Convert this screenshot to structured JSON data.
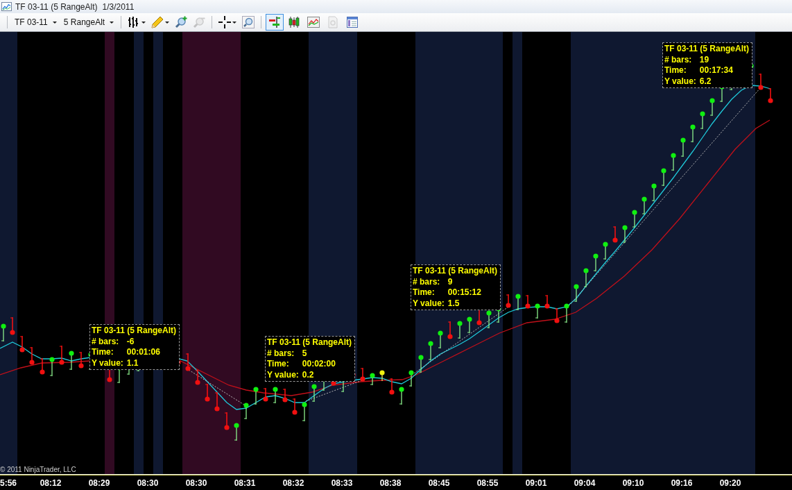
{
  "window": {
    "title": "TF 03-11 (5 RangeAlt)",
    "date": "1/3/2011"
  },
  "toolbar": {
    "instrument": "TF 03-11",
    "period": "5 RangeAlt",
    "tools": [
      {
        "disabled": false
      },
      {
        "disabled": false
      },
      {
        "disabled": false
      },
      {
        "disabled": true
      },
      {
        "disabled": false
      },
      {
        "disabled": false
      }
    ],
    "panels": [
      {
        "selected": true,
        "disabled": false
      },
      {
        "selected": false,
        "disabled": false
      },
      {
        "selected": false,
        "disabled": false
      },
      {
        "selected": false,
        "disabled": true
      },
      {
        "selected": false,
        "disabled": false
      }
    ]
  },
  "chart": {
    "measurements": [
      {
        "title": "TF 03-11 (5 RangeAlt)",
        "rows": [
          {
            "label": "# bars:",
            "value": "-6"
          },
          {
            "label": "Time:",
            "value": "00:01:06"
          },
          {
            "label": "Y value:",
            "value": "1.1"
          }
        ]
      },
      {
        "title": "TF 03-11 (5 RangeAlt)",
        "rows": [
          {
            "label": "# bars:",
            "value": "5"
          },
          {
            "label": "Time:",
            "value": "00:02:00"
          },
          {
            "label": "Y value:",
            "value": "0.2"
          }
        ]
      },
      {
        "title": "TF 03-11 (5 RangeAlt)",
        "rows": [
          {
            "label": "# bars:",
            "value": "9"
          },
          {
            "label": "Time:",
            "value": "00:15:12"
          },
          {
            "label": "Y value:",
            "value": "1.5"
          }
        ]
      },
      {
        "title": "TF 03-11 (5 RangeAlt)",
        "rows": [
          {
            "label": "# bars:",
            "value": "19"
          },
          {
            "label": "Time:",
            "value": "00:17:34"
          },
          {
            "label": "Y value:",
            "value": "6.2"
          }
        ]
      }
    ],
    "copyright": "© 2011 NinjaTrader, LLC",
    "time_axis": [
      "5:56",
      "08:12",
      "08:29",
      "08:30",
      "08:30",
      "08:31",
      "08:32",
      "08:33",
      "08:38",
      "08:45",
      "08:55",
      "09:01",
      "09:04",
      "09:10",
      "09:16",
      "09:20"
    ]
  }
}
